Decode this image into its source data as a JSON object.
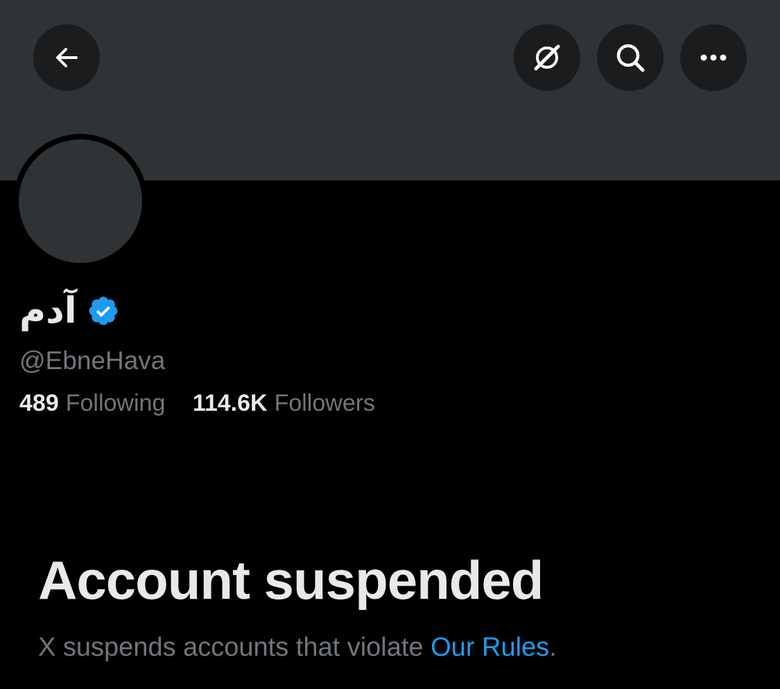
{
  "header": {
    "back_icon": "arrow-left-icon",
    "grok_icon": "grok-icon",
    "search_icon": "search-icon",
    "more_icon": "more-horizontal-icon"
  },
  "profile": {
    "display_name": "آدم",
    "verified": true,
    "verified_color": "#1d9bf0",
    "handle": "@EbneHava",
    "following_count": "489",
    "following_label": "Following",
    "followers_count": "114.6K",
    "followers_label": "Followers"
  },
  "suspension": {
    "title": "Account suspended",
    "message_prefix": "X suspends accounts that violate ",
    "rules_link": "Our Rules",
    "message_suffix": "."
  },
  "colors": {
    "background": "#000000",
    "banner": "#2f3336",
    "button_bg": "#1a1c1e",
    "primary_text": "#e7e9ea",
    "secondary_text": "#71767b",
    "link": "#1d9bf0"
  }
}
